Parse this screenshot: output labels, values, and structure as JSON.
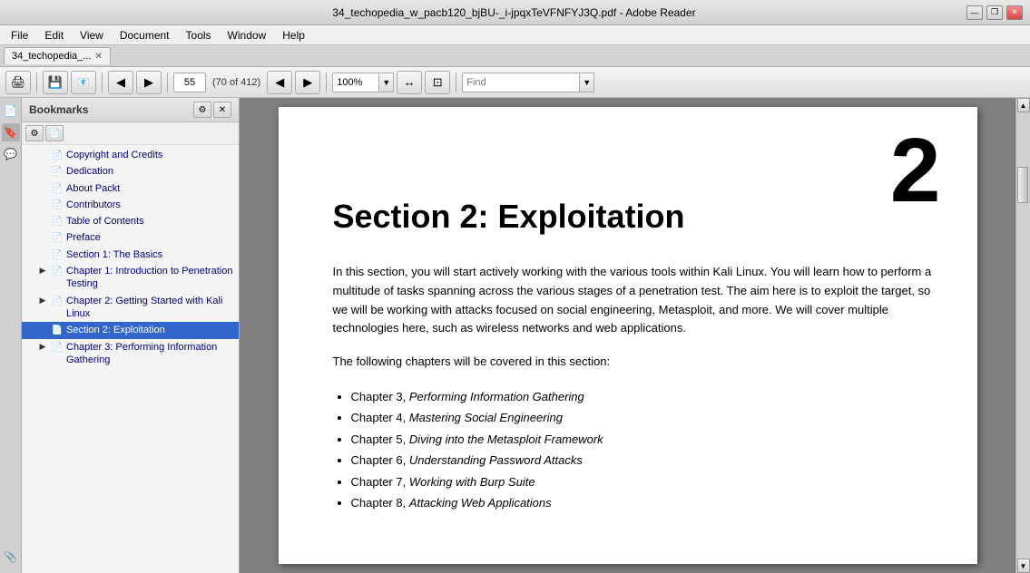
{
  "titleBar": {
    "title": "34_techopedia_w_pacb120_bjBU-_i-jpqxTeVFNFYJ3Q.pdf - Adobe Reader",
    "minBtn": "—",
    "restoreBtn": "❐",
    "closeBtn": "✕"
  },
  "menuBar": {
    "items": [
      "File",
      "Edit",
      "View",
      "Document",
      "Tools",
      "Window",
      "Help"
    ]
  },
  "tab": {
    "label": "34_techopedia_...",
    "closeBtn": "✕"
  },
  "toolbar": {
    "printBtn": "🖨",
    "saveBtn": "💾",
    "emailBtn": "✉",
    "backBtn": "◀",
    "forwardBtn": "▶",
    "pageNum": "55",
    "pageInfo": "(70 of 412)",
    "prevPageBtn": "◀",
    "nextPageBtn": "▶",
    "zoom": "100%",
    "fitWidthBtn": "↔",
    "fitPageBtn": "⊡",
    "findPlaceholder": "Find",
    "findDropBtn": "▼"
  },
  "bookmarkPanel": {
    "title": "Bookmarks",
    "closeBtn": "✕",
    "items": [
      {
        "id": "copyright",
        "label": "Copyright and Credits",
        "indent": 1,
        "expanded": false,
        "hasExpand": false,
        "icon": "📄"
      },
      {
        "id": "dedication",
        "label": "Dedication",
        "indent": 1,
        "expanded": false,
        "hasExpand": false,
        "icon": "📄"
      },
      {
        "id": "aboutpackt",
        "label": "About Packt",
        "indent": 1,
        "expanded": false,
        "hasExpand": false,
        "icon": "📄"
      },
      {
        "id": "contributors",
        "label": "Contributors",
        "indent": 1,
        "expanded": false,
        "hasExpand": false,
        "icon": "📄"
      },
      {
        "id": "toc",
        "label": "Table of Contents",
        "indent": 1,
        "expanded": false,
        "hasExpand": false,
        "icon": "📄"
      },
      {
        "id": "preface",
        "label": "Preface",
        "indent": 1,
        "expanded": false,
        "hasExpand": false,
        "icon": "📄"
      },
      {
        "id": "section1",
        "label": "Section 1: The Basics",
        "indent": 1,
        "expanded": false,
        "hasExpand": false,
        "icon": "📄"
      },
      {
        "id": "chapter1",
        "label": "Chapter 1: Introduction to Penetration Testing",
        "indent": 1,
        "expanded": true,
        "hasExpand": true,
        "icon": "📄"
      },
      {
        "id": "chapter2",
        "label": "Chapter 2: Getting Started with Kali Linux",
        "indent": 1,
        "expanded": true,
        "hasExpand": true,
        "icon": "📄"
      },
      {
        "id": "section2",
        "label": "Section 2: Exploitation",
        "indent": 1,
        "expanded": false,
        "hasExpand": false,
        "icon": "📄",
        "selected": true
      },
      {
        "id": "chapter3",
        "label": "Chapter 3: Performing Information Gathering",
        "indent": 1,
        "expanded": true,
        "hasExpand": true,
        "icon": "📄"
      }
    ]
  },
  "pdfPage": {
    "pageNumber": "2",
    "sectionTitle": "Section 2: Exploitation",
    "bodyText1": "In this section, you will start actively working with the various tools within Kali Linux. You will learn how to perform a multitude of tasks spanning across the various stages of a penetration test. The aim here is to exploit the target, so we will be working with attacks focused on social engineering, Metasploit, and more. We will cover multiple technologies here, such as wireless networks and web applications.",
    "bodyText2": "The following chapters will be covered in this section:",
    "chapters": [
      {
        "prefix": "Chapter 3, ",
        "italic": "Performing Information Gathering"
      },
      {
        "prefix": "Chapter 4, ",
        "italic": "Mastering Social Engineering"
      },
      {
        "prefix": "Chapter 5, ",
        "italic": "Diving into the Metasploit Framework"
      },
      {
        "prefix": "Chapter 6, ",
        "italic": "Understanding Password Attacks"
      },
      {
        "prefix": "Chapter 7, ",
        "italic": "Working with Burp Suite"
      },
      {
        "prefix": "Chapter 8, ",
        "italic": "Attacking Web Applications"
      }
    ]
  },
  "sidebarIcons": [
    {
      "id": "pages",
      "icon": "📄"
    },
    {
      "id": "bookmarks",
      "icon": "🔖"
    },
    {
      "id": "attachments",
      "icon": "📎"
    },
    {
      "id": "layers",
      "icon": "≡"
    },
    {
      "id": "comments",
      "icon": "💬"
    },
    {
      "id": "clip",
      "icon": "📎"
    }
  ]
}
